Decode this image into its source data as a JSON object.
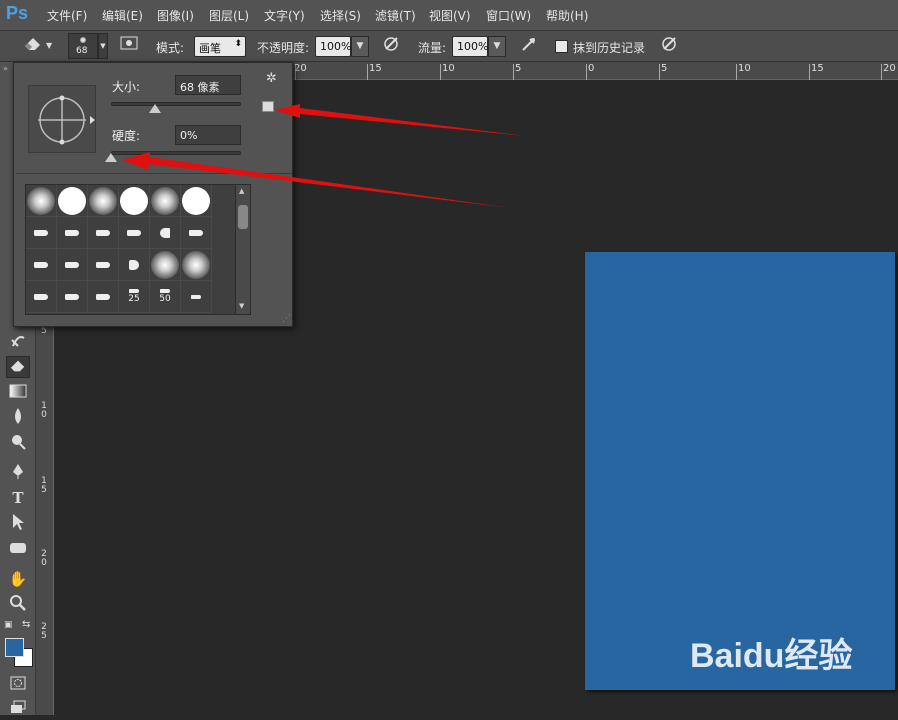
{
  "app": {
    "logo": "Ps"
  },
  "menu": [
    "文件(F)",
    "编辑(E)",
    "图像(I)",
    "图层(L)",
    "文字(Y)",
    "选择(S)",
    "滤镜(T)",
    "视图(V)",
    "窗口(W)",
    "帮助(H)"
  ],
  "options": {
    "brush_size": "68",
    "mode_label": "模式:",
    "mode_value": "画笔",
    "opacity_label": "不透明度:",
    "opacity_value": "100%",
    "flow_label": "流量:",
    "flow_value": "100%",
    "erase_history_label": "抹到历史记录"
  },
  "brush_panel": {
    "size_label": "大小:",
    "size_value": "68 像素",
    "size_fraction": 0.34,
    "hardness_label": "硬度:",
    "hardness_value": "0%",
    "hardness_fraction": 0.0,
    "preset_numbers": [
      "25",
      "50"
    ]
  },
  "ruler_top": [
    "20",
    "15",
    "10",
    "5",
    "0",
    "5",
    "10",
    "15",
    "20"
  ],
  "ruler_left": [
    "5",
    "10",
    "15",
    "20",
    "25"
  ],
  "watermark": "Baidu经验",
  "colors": {
    "foreground": "#2766a1",
    "background": "#ffffff",
    "arrow": "#e01010"
  }
}
